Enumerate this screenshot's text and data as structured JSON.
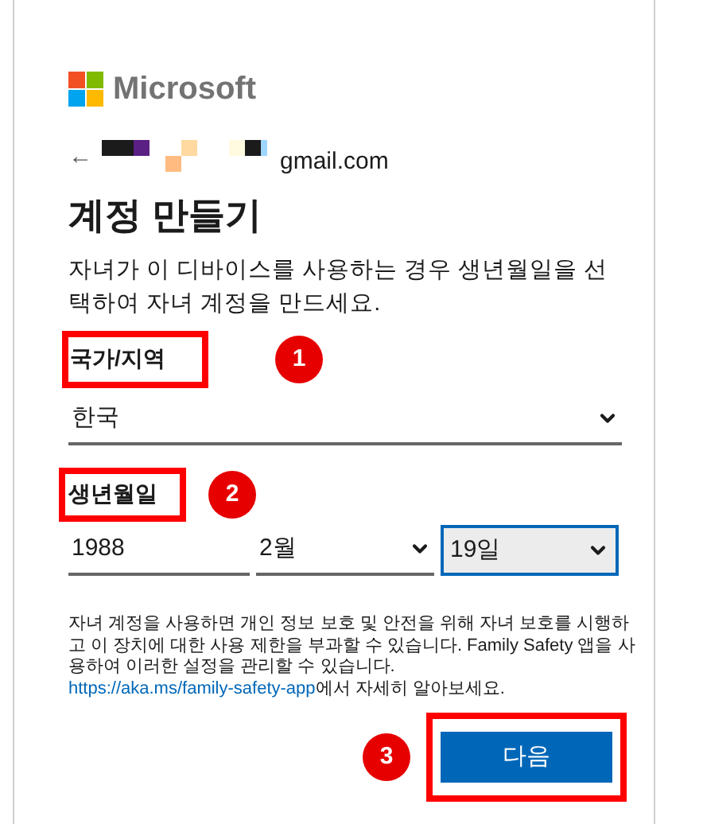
{
  "logo": {
    "text": "Microsoft"
  },
  "account": {
    "back": "←",
    "email": "gmail.com"
  },
  "title": "계정 만들기",
  "description": "자녀가 이 디바이스를 사용하는 경우 생년월일을 선택하여 자녀 계정을 만드세요.",
  "country": {
    "label": "국가/지역",
    "value": "한국",
    "annotation": "1",
    "highlighted": true
  },
  "birthdate": {
    "label": "생년월일",
    "annotation": "2",
    "highlighted": true,
    "fields": [
      {
        "kind": "text",
        "value": "1988",
        "focused": false
      },
      {
        "kind": "select",
        "value": "2월",
        "focused": false
      },
      {
        "kind": "select",
        "value": "19일",
        "focused": true
      }
    ]
  },
  "notice": {
    "text": "자녀 계정을 사용하면 개인 정보 보호 및 안전을 위해 자녀 보호를 시행하고 이 장치에 대한 사용 제한을 부과할 수 있습니다. Family Safety 앱을 사용하여 이러한 설정을 관리할 수 있습니다. ",
    "link": "https://aka.ms/family-safety-app",
    "after": "에서 자세히 알아보세요."
  },
  "next_button": {
    "label": "다음",
    "annotation": "3",
    "highlighted": true
  }
}
